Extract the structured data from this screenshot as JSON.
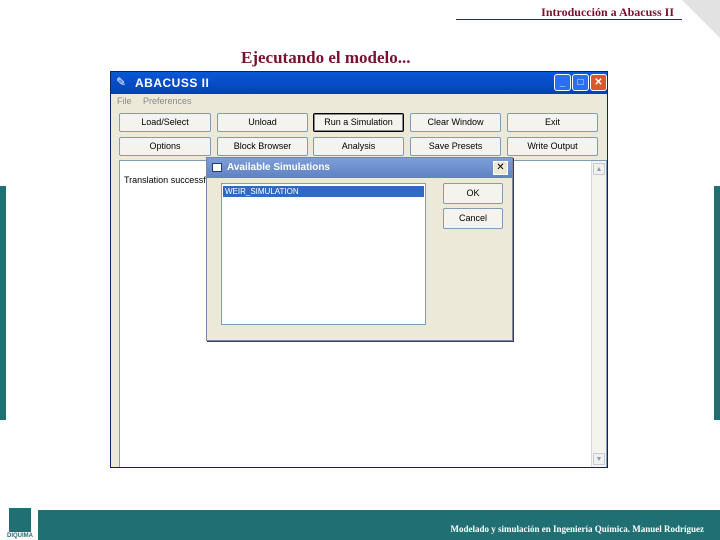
{
  "slide": {
    "header": "Introducción a Abacuss II",
    "title": "Ejecutando el modelo...",
    "footer": "Modelado y simulación en Ingeniería Química.  Manuel Rodríguez",
    "logo_text": "DIQUIMA",
    "accent_color": "#1f6f73",
    "title_color": "#7a1030"
  },
  "app": {
    "title": "ABACUSS II",
    "icon": "pencil-icon",
    "window_controls": {
      "minimize": "_",
      "maximize": "□",
      "close": "✕"
    },
    "menu": [
      "File",
      "Preferences"
    ],
    "buttons_row1": [
      "Load/Select",
      "Unload",
      "Run a Simulation",
      "Clear Window",
      "Exit"
    ],
    "buttons_row2": [
      "Options",
      "Block Browser",
      "Analysis",
      "Save Presets",
      "Write Output"
    ],
    "output_text": "Translation successful."
  },
  "dialog": {
    "title": "Available Simulations",
    "close": "✕",
    "simulations": [
      "WEIR_SIMULATION"
    ],
    "selected": "WEIR_SIMULATION",
    "ok_label": "OK",
    "cancel_label": "Cancel"
  }
}
